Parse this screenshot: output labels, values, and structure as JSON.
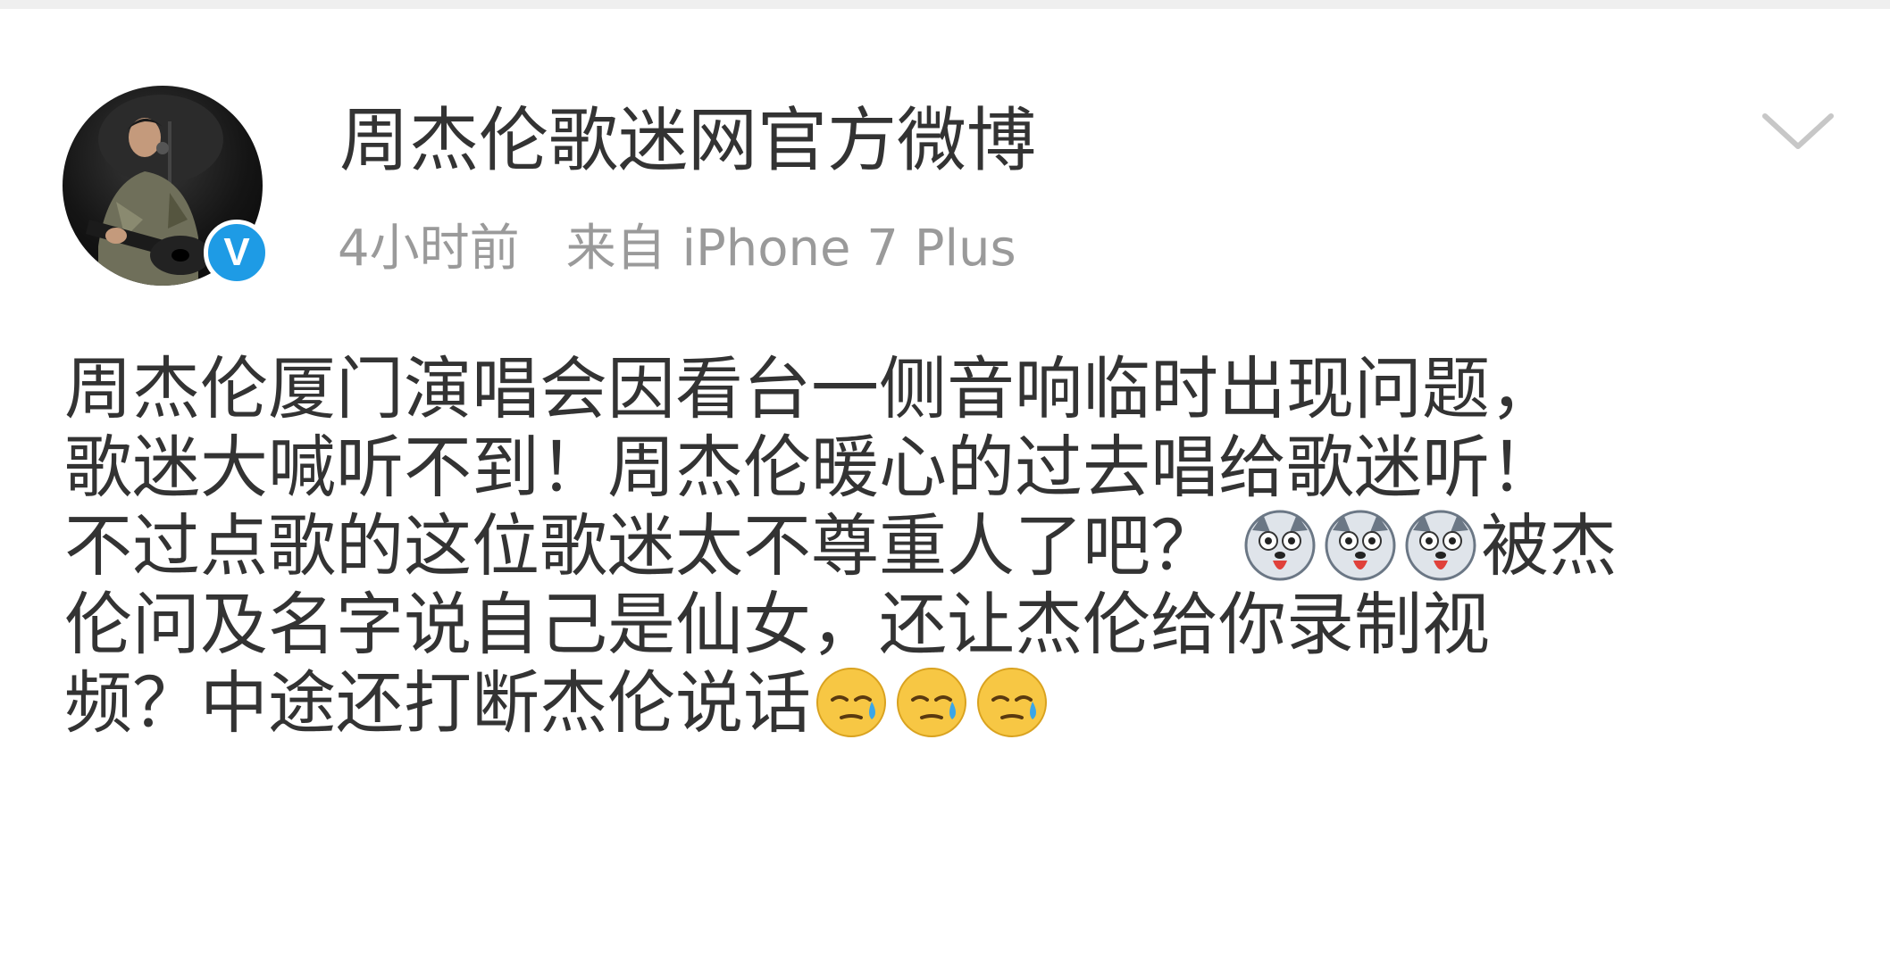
{
  "post": {
    "author": {
      "name": "周杰伦歌迷网官方微博",
      "verified_badge": "V",
      "verified_color": "#1e9be5"
    },
    "time": "4小时前",
    "source": "来自 iPhone 7 Plus",
    "more_icon": "chevron-down-icon",
    "body": {
      "line1": "周杰伦厦门演唱会因看台一侧音响临时出现问题，",
      "line2": "歌迷大喊听不到！周杰伦暖心的过去唱给歌迷听！",
      "line3_text": "不过点歌的这位歌迷太不尊重人了吧？",
      "line3_emoji": "husky-emoji",
      "line3_tail": "被杰",
      "line4": "伦问及名字说自己是仙女，还让杰伦给你录制视",
      "line5_text": "频？中途还打断杰伦说话",
      "line5_emoji": "sweat-face-emoji"
    }
  }
}
